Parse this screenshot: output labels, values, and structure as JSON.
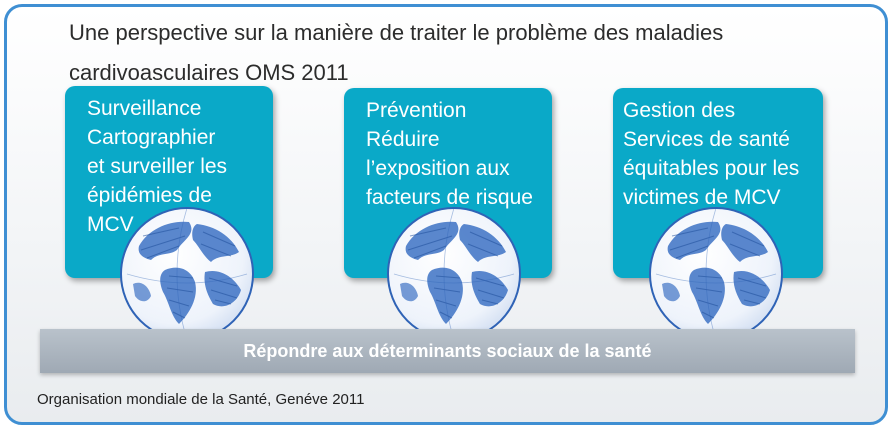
{
  "title": {
    "line1": "Une perspective sur la manière de traiter le problème des maladies",
    "line2": "cardivoasculaires OMS 2011"
  },
  "cards": [
    {
      "lines": [
        "Surveillance",
        "Cartographier",
        "et surveiller les",
        "épidémies de",
        "MCV"
      ]
    },
    {
      "lines": [
        "Prévention",
        "Réduire",
        "l’exposition aux",
        "facteurs de risque"
      ]
    },
    {
      "lines": [
        "Gestion des",
        "Services de santé",
        "équitables pour les",
        "victimes de MCV"
      ]
    }
  ],
  "base_bar": {
    "label": "Répondre aux déterminants sociaux de la santé"
  },
  "source": "Organisation mondiale de la Santé, Genéve 2011",
  "colors": {
    "frame": "#3f8fd3",
    "card": "#0aa9c8",
    "bar": "#a9b2bc",
    "globe": "#2f63b6"
  },
  "icons": [
    "globe-icon"
  ]
}
